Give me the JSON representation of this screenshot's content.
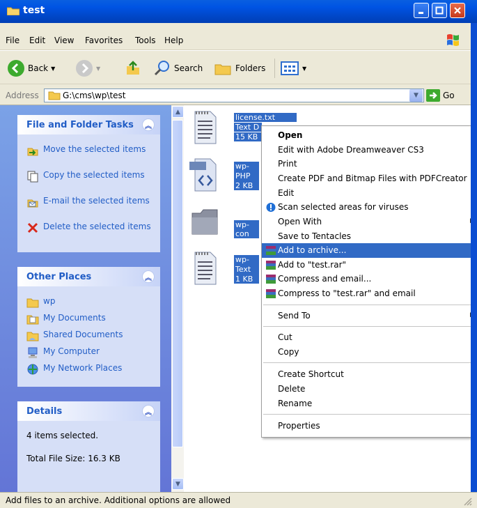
{
  "window": {
    "title": "test",
    "colors": {
      "titlebar": "#0054e3",
      "selection": "#316ac5",
      "task_link": "#215dc6"
    }
  },
  "menubar": {
    "items": [
      "File",
      "Edit",
      "View",
      "Favorites",
      "Tools",
      "Help"
    ]
  },
  "toolbar": {
    "back_label": "Back",
    "search_label": "Search",
    "folders_label": "Folders"
  },
  "address": {
    "label": "Address",
    "value": "G:\\cms\\wp\\test",
    "go_label": "Go"
  },
  "left_pane": {
    "tasks": {
      "title": "File and Folder Tasks",
      "items": [
        {
          "label": "Move the selected items",
          "icon": "move-icon"
        },
        {
          "label": "Copy the selected items",
          "icon": "copy-icon"
        },
        {
          "label": "E-mail the selected items",
          "icon": "email-icon"
        },
        {
          "label": "Delete the selected items",
          "icon": "delete-icon"
        }
      ]
    },
    "places": {
      "title": "Other Places",
      "items": [
        {
          "label": "wp",
          "icon": "folder-icon"
        },
        {
          "label": "My Documents",
          "icon": "my-documents-icon"
        },
        {
          "label": "Shared Documents",
          "icon": "shared-documents-icon"
        },
        {
          "label": "My Computer",
          "icon": "my-computer-icon"
        },
        {
          "label": "My Network Places",
          "icon": "network-places-icon"
        }
      ]
    },
    "details": {
      "title": "Details",
      "selected": "4 items selected.",
      "total_size": "Total File Size: 16.3 KB"
    }
  },
  "files": [
    {
      "name": "license.txt",
      "type": "Text D",
      "size": "15 KB",
      "icon": "text-file-icon"
    },
    {
      "name": "wp-con",
      "type": "PHP Sc",
      "size": "2 KB",
      "icon": "php-file-icon"
    },
    {
      "name": "wp-con",
      "type": "",
      "size": "",
      "icon": "folder-icon"
    },
    {
      "name": "wp-per",
      "type": "Text D",
      "size": "1 KB",
      "icon": "text-file-icon"
    }
  ],
  "context_menu": {
    "items": [
      {
        "label": "Open",
        "bold": true
      },
      {
        "label": "Edit with Adobe Dreamweaver CS3"
      },
      {
        "label": "Print"
      },
      {
        "label": "Create PDF and Bitmap Files with PDFCreator"
      },
      {
        "label": "Edit"
      },
      {
        "label": "Scan selected areas for viruses",
        "icon": "antivirus-icon"
      },
      {
        "label": "Open With",
        "submenu": true
      },
      {
        "label": "Save to Tentacles"
      },
      {
        "label": "Add to archive...",
        "icon": "winrar-icon",
        "selected": true
      },
      {
        "label": "Add to \"test.rar\"",
        "icon": "winrar-icon"
      },
      {
        "label": "Compress and email...",
        "icon": "winrar-icon"
      },
      {
        "label": "Compress to \"test.rar\" and email",
        "icon": "winrar-icon"
      },
      {
        "label": "Send To",
        "submenu": true
      },
      {
        "label": "Cut"
      },
      {
        "label": "Copy"
      },
      {
        "label": "Create Shortcut"
      },
      {
        "label": "Delete"
      },
      {
        "label": "Rename"
      },
      {
        "label": "Properties"
      }
    ]
  },
  "status_bar": {
    "text": "Add files to an archive. Additional options are allowed"
  }
}
